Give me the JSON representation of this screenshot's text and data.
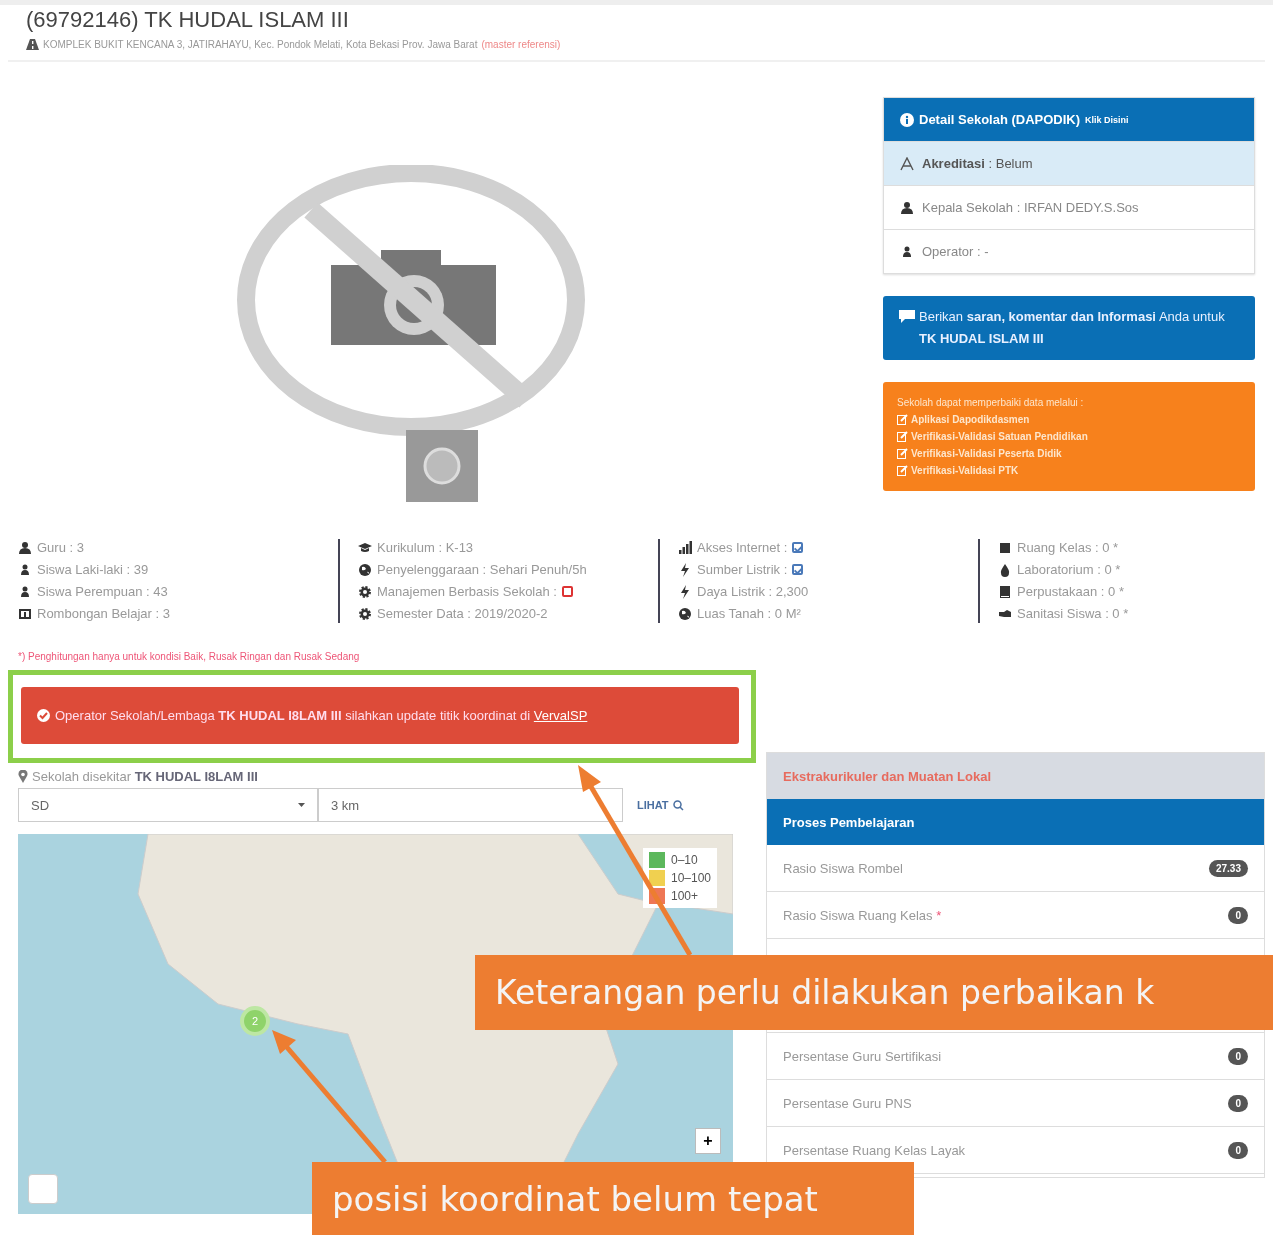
{
  "header": {
    "title": "(69792146) TK HUDAL ISLAM III",
    "address": "KOMPLEK BUKIT KENCANA 3, JATIRAHAYU, Kec. Pondok Melati, Kota Bekasi Prov. Jawa Barat",
    "address_link": "(master referensi)"
  },
  "detail_panel": {
    "title": "Detail Sekolah (DAPODIK)",
    "hint": "Klik Disini",
    "rows": [
      {
        "kind": "accreditation",
        "label": "Akreditasi",
        "value": ": Belum"
      },
      {
        "kind": "head",
        "label": "Kepala Sekolah : IRFAN DEDY.S.Sos"
      },
      {
        "kind": "operator",
        "label": "Operator : -"
      }
    ]
  },
  "feedback_box": {
    "text": "Berikan **saran, komentar dan Informasi** Anda untuk **TK HUDAL ISLAM III**"
  },
  "repair_box": {
    "intro": "Sekolah dapat memperbaiki data melalui :",
    "links": [
      "Aplikasi Dapodikdasmen",
      "Verifikasi-Validasi Satuan Pendidikan",
      "Verifikasi-Validasi Peserta Didik",
      "Verifikasi-Validasi PTK"
    ]
  },
  "stats": {
    "columns": [
      {
        "items": [
          {
            "kind": "user",
            "label": "Guru : 3"
          },
          {
            "kind": "person",
            "label": "Siswa Laki-laki : 39"
          },
          {
            "kind": "person",
            "label": "Siswa Perempuan : 43"
          },
          {
            "kind": "board",
            "label": "Rombongan Belajar : 3"
          }
        ]
      },
      {
        "items": [
          {
            "kind": "cap",
            "label": "Kurikulum : K-13"
          },
          {
            "kind": "globe",
            "label": "Penyelenggaraan : Sehari Penuh/5h"
          },
          {
            "kind": "gear",
            "label": "Manajemen Berbasis Sekolah :",
            "checked": false
          },
          {
            "kind": "gear",
            "label": "Semester Data : 2019/2020-2"
          }
        ]
      },
      {
        "items": [
          {
            "kind": "signal",
            "label": "Akses Internet :",
            "checked": true
          },
          {
            "kind": "bolt",
            "label": "Sumber Listrik :",
            "checked": true
          },
          {
            "kind": "bolt",
            "label": "Daya Listrik : 2,300"
          },
          {
            "kind": "globe",
            "label": "Luas Tanah : 0 M²"
          }
        ]
      },
      {
        "items": [
          {
            "kind": "square",
            "label": "Ruang Kelas : 0 *"
          },
          {
            "kind": "drop",
            "label": "Laboratorium : 0 *"
          },
          {
            "kind": "book",
            "label": "Perpustakaan : 0 *"
          },
          {
            "kind": "hand",
            "label": "Sanitasi Siswa : 0 *"
          }
        ]
      }
    ]
  },
  "footnote": "*) Penghitungan hanya untuk kondisi Baik, Rusak Ringan dan Rusak Sedang",
  "alert": {
    "text": "Operator Sekolah/Lembaga **TK HUDAL I8LAM III** silahkan update titik koordinat di",
    "link": "VervalSP"
  },
  "nearby": {
    "label": "Sekolah disekitar **TK HUDAL I8LAM III**",
    "level_select": "SD",
    "distance_field": "3 km",
    "button": "LIHAT"
  },
  "map": {
    "legend": [
      {
        "label": "0–10",
        "color": "#5cb85c"
      },
      {
        "label": "10–100",
        "color": "#f0d050"
      },
      {
        "label": "100+",
        "color": "#ee7755"
      }
    ],
    "cluster_count": "2",
    "zoom_button": "+"
  },
  "indicators": {
    "tabs": [
      {
        "label": "Ekstrakurikuler dan Muatan Lokal",
        "selected": false
      },
      {
        "label": "Proses Pembelajaran",
        "selected": true
      }
    ],
    "rows": [
      {
        "label": "Rasio Siswa Rombel",
        "badge": "27.33"
      },
      {
        "label": "Rasio Siswa Ruang Kelas",
        "note": "*",
        "badge": "0"
      }
    ],
    "rows_below_callout": [
      {
        "label": "Persentase Guru Sertifikasi",
        "badge": "0"
      },
      {
        "label": "Persentase Guru PNS",
        "badge": "0"
      },
      {
        "label": "Persentase Ruang Kelas Layak",
        "badge": "0"
      }
    ]
  },
  "annotations": [
    {
      "kind": "callout",
      "text": "Keterangan perlu dilakukan perbaikan k"
    },
    {
      "kind": "callout",
      "text": "posisi koordinat belum tepat"
    }
  ]
}
